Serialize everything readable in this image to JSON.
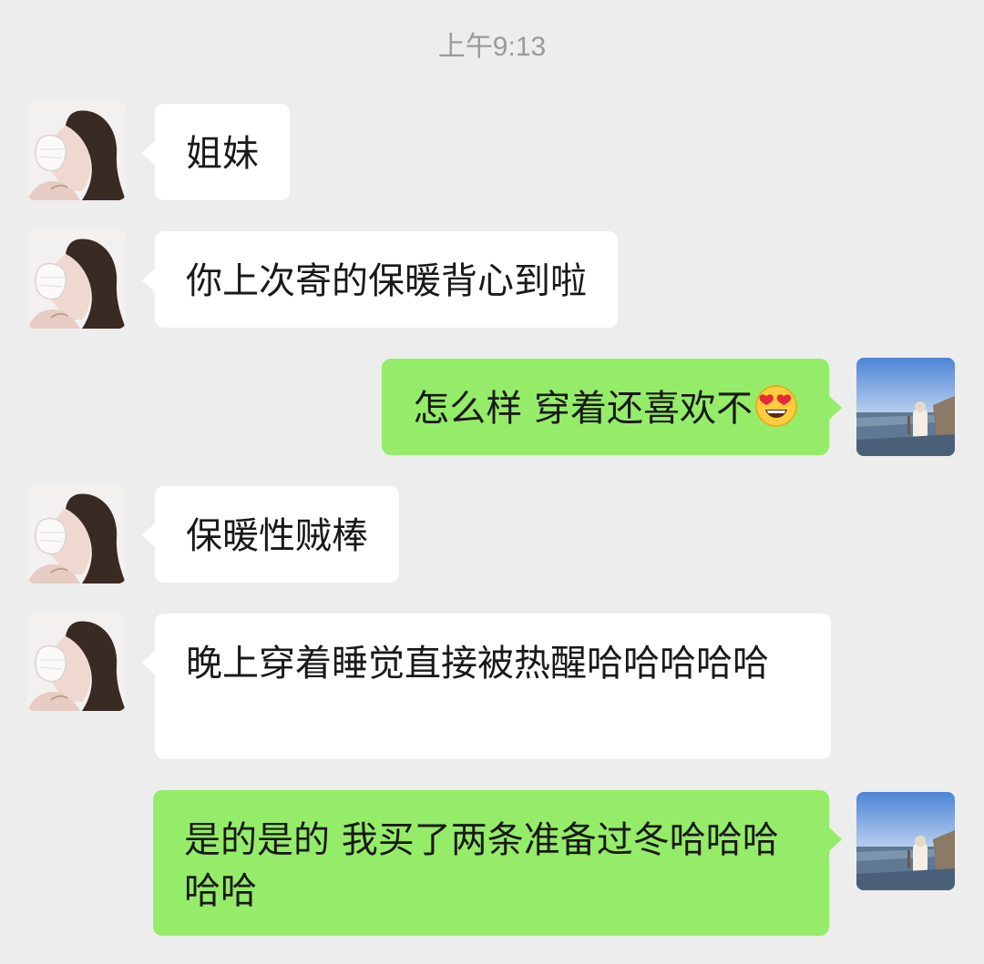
{
  "chat": {
    "timestamp": "上午9:13",
    "messages": [
      {
        "side": "in",
        "text": "姐妹"
      },
      {
        "side": "in",
        "text": "你上次寄的保暖背心到啦"
      },
      {
        "side": "out",
        "text": "怎么样 穿着还喜欢不",
        "emoji": "heart-eyes-emoji"
      },
      {
        "side": "in",
        "text": "保暖性贼棒"
      },
      {
        "side": "in",
        "text": "晚上穿着睡觉直接被热醒哈哈哈哈哈"
      },
      {
        "side": "out",
        "text": "是的是的 我买了两条准备过冬哈哈哈哈哈"
      }
    ]
  },
  "colors": {
    "background": "#ededed",
    "incoming_bubble": "#ffffff",
    "outgoing_bubble": "#95ec69",
    "timestamp_text": "#9a9a9a"
  },
  "icons": {
    "contact_avatar": "woman-profile-illustration-avatar",
    "self_avatar": "seaside-photo-avatar"
  }
}
